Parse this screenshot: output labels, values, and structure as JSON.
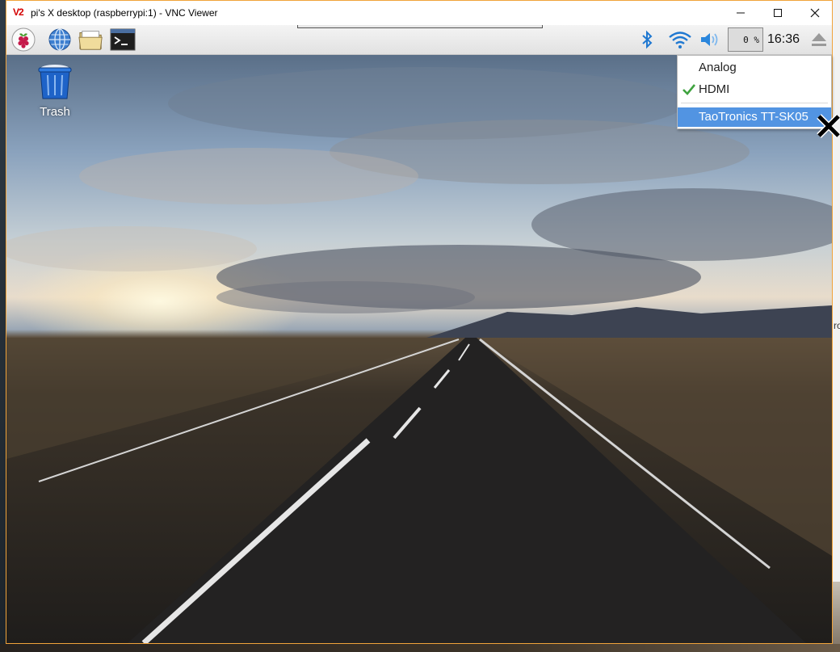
{
  "host": {
    "right_edge_fragment": "ro"
  },
  "window": {
    "app_logo_text": "V2",
    "title": "pi's X desktop (raspberrypi:1) - VNC Viewer",
    "controls": [
      "minimize-icon",
      "maximize-icon",
      "close-icon"
    ]
  },
  "panel": {
    "launchers": [
      "raspberry-menu-icon",
      "web-browser-icon",
      "file-manager-icon",
      "terminal-icon"
    ],
    "tray_icons": [
      "bluetooth-icon",
      "wifi-icon",
      "volume-icon",
      "eject-icon"
    ],
    "cpu_usage": "0 %",
    "clock": "16:36"
  },
  "desktop": {
    "icons": [
      {
        "label": "Trash",
        "icon": "trash-icon"
      }
    ]
  },
  "audio_menu": {
    "items": [
      {
        "label": "Analog",
        "checked": false,
        "highlighted": false
      },
      {
        "label": "HDMI",
        "checked": true,
        "highlighted": false
      },
      {
        "label": "TaoTronics TT-SK05",
        "checked": false,
        "highlighted": true
      }
    ]
  },
  "colors": {
    "window_border": "#f0a33a",
    "menu_highlight": "#5294e2",
    "check_mark": "#3fa33f",
    "tray_icon_blue": "#1f78d1"
  },
  "cursor": "x-cursor-icon"
}
